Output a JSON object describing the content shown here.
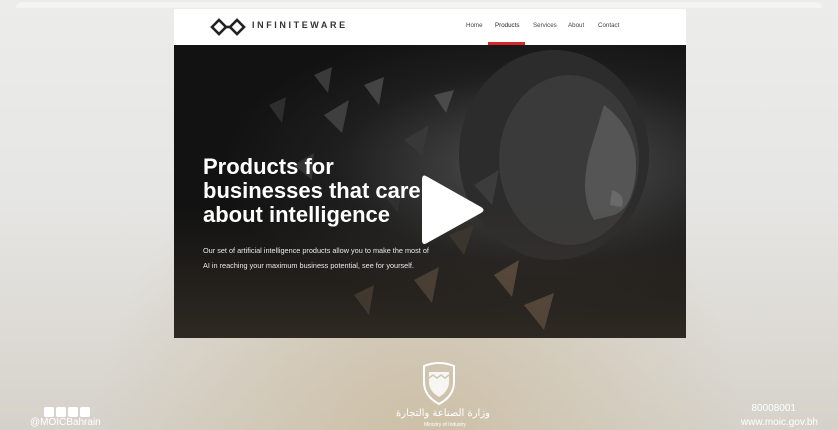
{
  "site": {
    "brand": "INFINITEWARE",
    "nav": [
      "Home",
      "Products",
      "Services",
      "About",
      "Contact"
    ],
    "active_nav": "Products",
    "accent_color": "#d9262c",
    "hero": {
      "headline_lines": [
        "Products for",
        "businesses that care",
        "about intelligence"
      ],
      "sub_lines": [
        "Our set of artificial intelligence products allow you to make the most of",
        "AI in reaching your maximum business potential, see for yourself."
      ]
    }
  },
  "video": {
    "play_icon": "play-icon"
  },
  "footer": {
    "social_icons": [
      "twitter-icon",
      "facebook-icon",
      "instagram-icon",
      "youtube-icon"
    ],
    "handle": "@MOICBahrain",
    "phone": "80008001",
    "website": "www.moic.gov.bh",
    "ministry_ar": "وزارة الصناعة والتجارة",
    "ministry_en": "Ministry of Industry"
  }
}
